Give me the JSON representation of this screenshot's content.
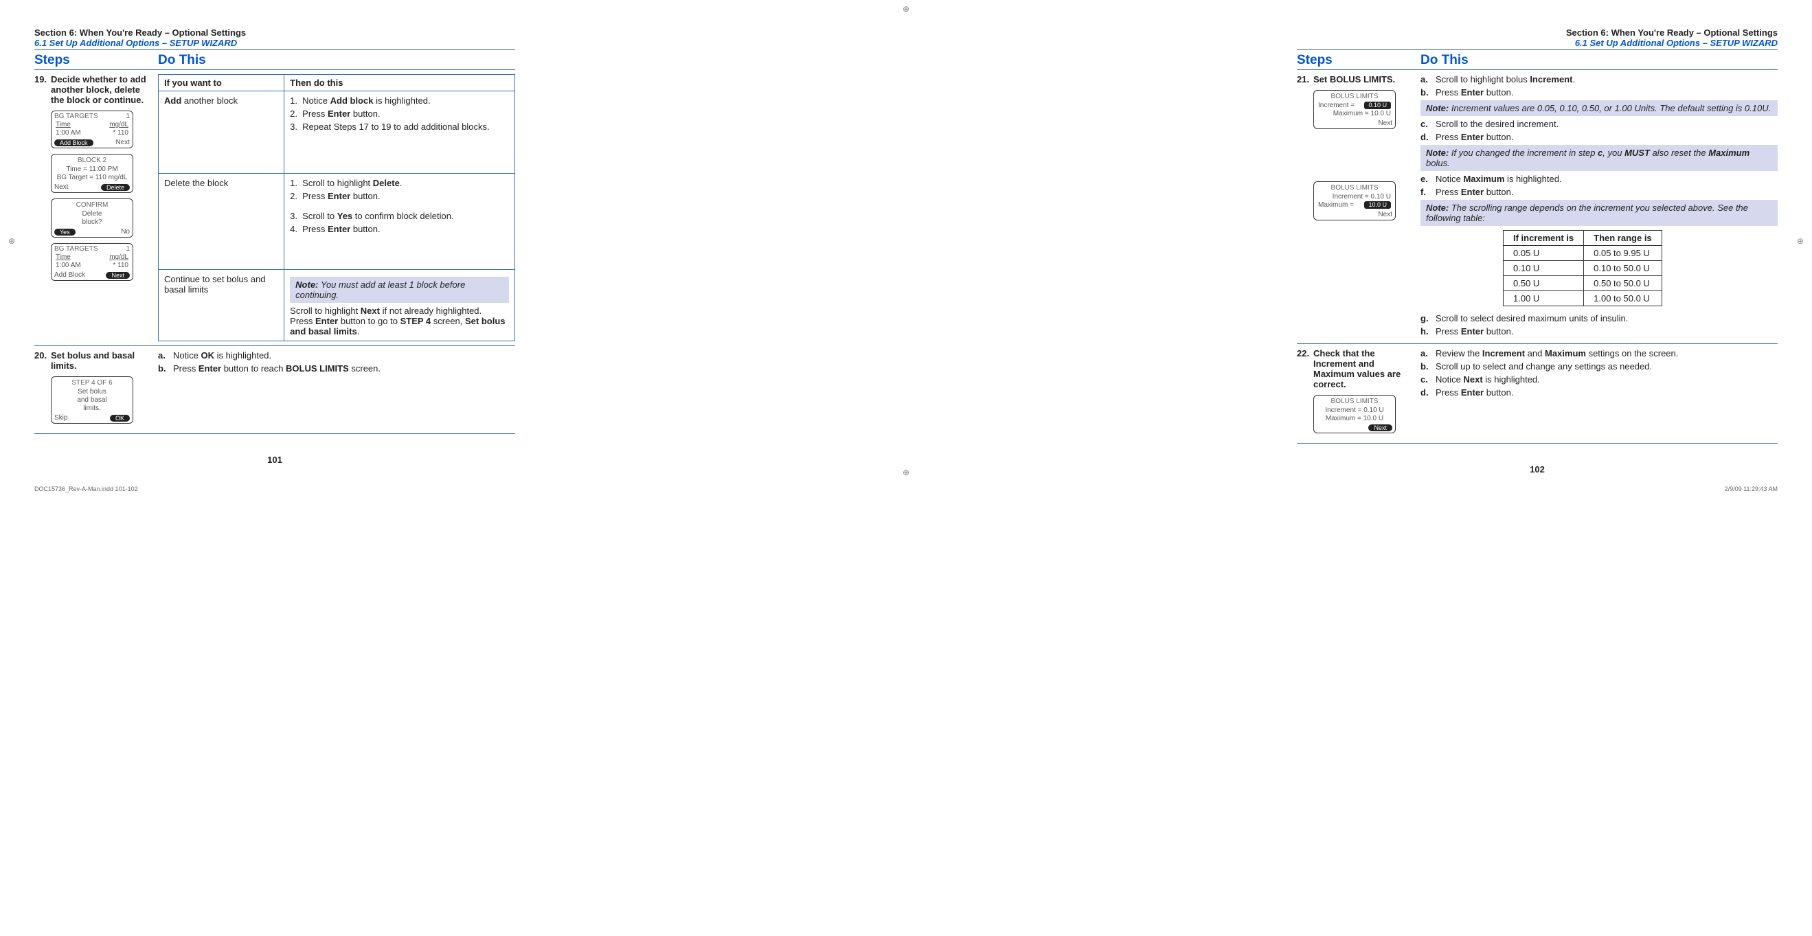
{
  "reg_mark": "⊕",
  "section_hdr": "Section 6: When You're Ready – Optional Settings",
  "section_sub": "6.1 Set Up Additional Options – SETUP WIZARD",
  "col_steps": "Steps",
  "col_do": "Do This",
  "footer_left": "DOC15736_Rev-A-Man.indd   101-102",
  "footer_right": "2/9/09   11:29:43 AM",
  "p101": {
    "pgnum": "101",
    "step19": {
      "num": "19.",
      "txt": "Decide whether to add another block, delete the block or continue.",
      "tbl_h1": "If you want to",
      "tbl_h2": "Then do this",
      "r1c1_a": "Add ",
      "r1c1_b": "another block",
      "r1_1": "Notice ",
      "r1_1b": "Add block",
      "r1_1c": " is highlighted.",
      "r1_2": "Press ",
      "r1_2b": "Enter",
      "r1_2c": " button.",
      "r1_3": "Repeat Steps 17 to 19 to add additional blocks.",
      "r2c1": "Delete the block",
      "r2_1": "Scroll to highlight ",
      "r2_1b": "Delete",
      "r2_1c": ".",
      "r2_2": "Press ",
      "r2_2b": "Enter",
      "r2_2c": " button.",
      "r2_3": "Scroll to ",
      "r2_3b": "Yes",
      "r2_3c": " to confirm block deletion.",
      "r2_4": "Press ",
      "r2_4b": "Enter",
      "r2_4c": " button.",
      "r3c1": "Continue to set bolus and basal limits",
      "r3_note": "You must add at least 1 block before continuing.",
      "r3_a": "Scroll to highlight ",
      "r3_ab": "Next",
      "r3_ac": " if not already highlighted.",
      "r3_b": "Press ",
      "r3_bb": "Enter",
      "r3_bc": " button to go to ",
      "r3_bd": "STEP 4",
      "r3_be": " screen, ",
      "r3_bf": "Set bolus and basal limits",
      "r3_bg": ".",
      "scr1": {
        "title_l": "BG TARGETS",
        "title_r": "1",
        "h1": "Time",
        "h2": "mg/dL",
        "v1": "1:00 AM",
        "v2": "* 110",
        "b1": "Add Block",
        "b2": "Next"
      },
      "scr2": {
        "title": "BLOCK 2",
        "l1": "Time = 11:00 PM",
        "l2": "BG Target = 110 mg/dL",
        "b1": "Next",
        "b2": "Delete"
      },
      "scr3": {
        "title": "CONFIRM",
        "l1": "Delete",
        "l2": "block?",
        "b1": "Yes",
        "b2": "No"
      },
      "scr4": {
        "title_l": "BG TARGETS",
        "title_r": "1",
        "h1": "Time",
        "h2": "mg/dL",
        "v1": "1:00 AM",
        "v2": "* 110",
        "b1": "Add Block",
        "b2": "Next"
      }
    },
    "step20": {
      "num": "20.",
      "txt": "Set bolus and basal limits.",
      "a": "Notice ",
      "ab": "OK",
      "ac": " is highlighted.",
      "b": "Press ",
      "bb": "Enter",
      "bc": " button to reach ",
      "bd": "BOLUS LIMITS",
      "be": " screen.",
      "scr": {
        "title": "STEP 4 OF 6",
        "l1": "Set bolus",
        "l2": "and basal",
        "l3": "limits.",
        "b1": "Skip",
        "b2": "OK"
      }
    }
  },
  "p102": {
    "pgnum": "102",
    "step21": {
      "num": "21.",
      "txt": "Set BOLUS LIMITS.",
      "a": "Scroll to highlight bolus ",
      "ab": "Increment",
      "ac": ".",
      "b": "Press ",
      "bb": "Enter",
      "bc": " button.",
      "note1": "Increment values are 0.05, 0.10, 0.50, or 1.00 Units. The default setting is 0.10U.",
      "c": "Scroll to the desired increment.",
      "d": "Press ",
      "db": "Enter",
      "dc": " button.",
      "note2a": "If you changed the increment in step ",
      "note2b": "c",
      "note2c": ", you ",
      "note2d": "MUST",
      "note2e": " also reset the ",
      "note2f": "Maximum",
      "note2g": " bolus.",
      "e": "Notice ",
      "eb": "Maximum",
      "ec": " is highlighted.",
      "f": "Press ",
      "fb": "Enter",
      "fc": " button.",
      "note3": "The scrolling range depends on the increment you selected above. See the following table:",
      "tbl_h1": "If increment is",
      "tbl_h2": "Then range is",
      "tbl": [
        {
          "i": "0.05 U",
          "r": "0.05 to 9.95 U"
        },
        {
          "i": "0.10 U",
          "r": "0.10 to 50.0 U"
        },
        {
          "i": "0.50 U",
          "r": "0.50 to 50.0 U"
        },
        {
          "i": "1.00 U",
          "r": "1.00 to 50.0 U"
        }
      ],
      "g": "Scroll to select desired maximum units of insulin.",
      "h": "Press ",
      "hb": "Enter",
      "hc": " button.",
      "scr1": {
        "title": "BOLUS LIMITS",
        "l1a": "Increment =",
        "l1b": "0.10 U",
        "l2": "Maximum = 10.0 U",
        "b2": "Next"
      },
      "scr2": {
        "title": "BOLUS LIMITS",
        "l1": "Increment = 0.10 U",
        "l2a": "Maximum =",
        "l2b": "10.0 U",
        "b2": "Next"
      }
    },
    "step22": {
      "num": "22.",
      "txt": "Check that the Increment and Maximum values are correct.",
      "a": "Review the ",
      "ab": "Increment",
      "ac": " and ",
      "ad": "Maximum",
      "ae": " settings on the screen.",
      "b": "Scroll up to select and change any settings as needed.",
      "c": "Notice ",
      "cb": "Next",
      "cc": " is highlighted.",
      "d": "Press ",
      "db": "Enter",
      "dc": " button.",
      "scr": {
        "title": "BOLUS LIMITS",
        "l1": "Increment = 0.10 U",
        "l2": "Maximum = 10.0 U",
        "b2": "Next"
      }
    }
  },
  "note_label": "Note: "
}
